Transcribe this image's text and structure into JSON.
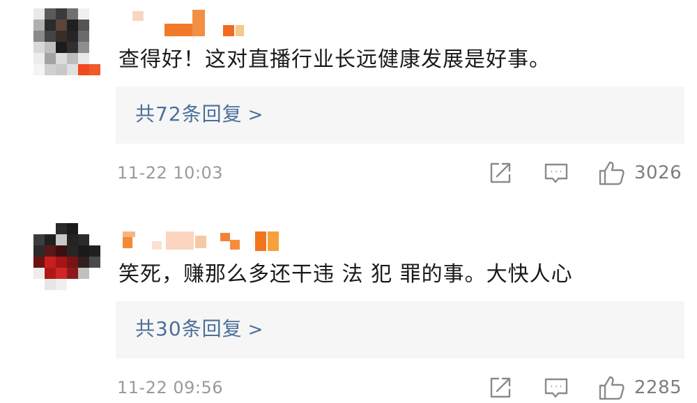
{
  "comments": [
    {
      "text": "查得好！这对直播行业长远健康发展是好事。",
      "replies_label": "共72条回复",
      "replies_chevron": ">",
      "time": "11-22 10:03",
      "likes": "3026",
      "icons": {
        "share": "share-icon",
        "comment": "comment-icon",
        "like": "thumbs-up-icon"
      }
    },
    {
      "text": "笑死，赚那么多还干违 法 犯 罪的事。大快人心",
      "replies_label": "共30条回复",
      "replies_chevron": ">",
      "time": "11-22 09:56",
      "likes": "2285",
      "icons": {
        "share": "share-icon",
        "comment": "comment-icon",
        "like": "thumbs-up-icon"
      }
    }
  ],
  "colors": {
    "reply_link": "#4a6f99",
    "meta_text": "#9a9a9a",
    "reply_box": "#f6f6f6",
    "mosaic_orange": "#f07a2a"
  }
}
